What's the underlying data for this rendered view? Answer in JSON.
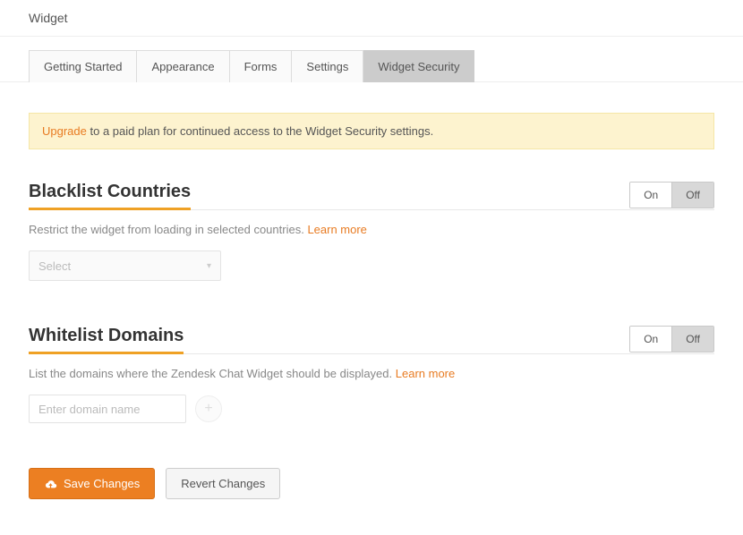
{
  "header": {
    "title": "Widget"
  },
  "tabs": [
    {
      "label": "Getting Started"
    },
    {
      "label": "Appearance"
    },
    {
      "label": "Forms"
    },
    {
      "label": "Settings"
    },
    {
      "label": "Widget Security"
    }
  ],
  "notice": {
    "link_text": "Upgrade",
    "rest_text": " to a paid plan for continued access to the Widget Security settings."
  },
  "toggle": {
    "on": "On",
    "off": "Off"
  },
  "blacklist": {
    "title": "Blacklist Countries",
    "desc": "Restrict the widget from loading in selected countries. ",
    "learn_more": "Learn more",
    "select_placeholder": "Select",
    "toggle_state": "off"
  },
  "whitelist": {
    "title": "Whitelist Domains",
    "desc": "List the domains where the Zendesk Chat Widget should be displayed. ",
    "learn_more": "Learn more",
    "input_placeholder": "Enter domain name",
    "toggle_state": "off"
  },
  "footer": {
    "save": "Save Changes",
    "revert": "Revert Changes"
  }
}
